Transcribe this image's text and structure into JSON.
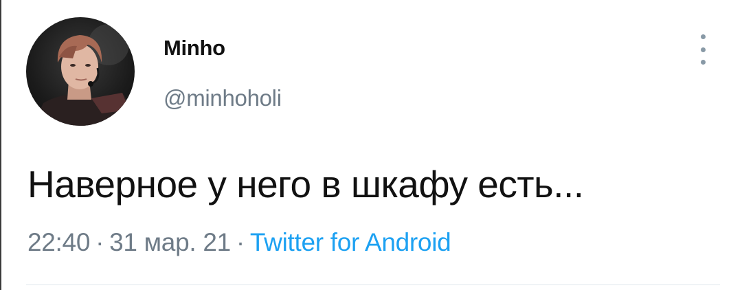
{
  "tweet": {
    "author": {
      "display_name": "Minho",
      "handle": "@minhoholi",
      "avatar_icon": "user-avatar-photo"
    },
    "text": "Наверное у него в шкафу есть...",
    "time": "22:40",
    "date": "31 мар. 21",
    "separator": "·",
    "source": "Twitter for Android"
  },
  "icons": {
    "more": "more-vertical-icon"
  },
  "colors": {
    "text_primary": "#111111",
    "text_secondary": "#6e7b87",
    "link": "#1da1f2",
    "divider": "#e1e8ed"
  }
}
